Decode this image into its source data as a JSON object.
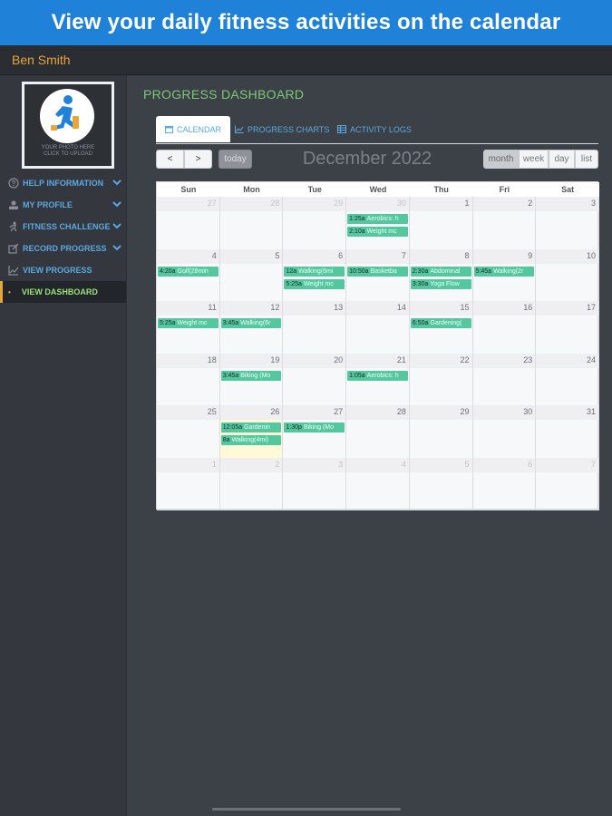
{
  "banner": {
    "title": "View your daily fitness activities on the calendar"
  },
  "user": {
    "name": "Ben Smith"
  },
  "profile": {
    "photo_caption_1": "YOUR PHOTO HERE",
    "photo_caption_2": "CLICK TO UPLOAD"
  },
  "sidebar": {
    "items": [
      {
        "label": "HELP INFORMATION",
        "icon": "question-icon"
      },
      {
        "label": "MY PROFILE",
        "icon": "profile-icon"
      },
      {
        "label": "FITNESS CHALLENGE",
        "icon": "runner-icon"
      },
      {
        "label": "RECORD PROGRESS",
        "icon": "record-icon"
      },
      {
        "label": "VIEW PROGRESS",
        "icon": "chart-icon"
      },
      {
        "label": "VIEW DASHBOARD",
        "icon": "bullet-icon"
      }
    ]
  },
  "dashboard": {
    "title": "PROGRESS DASHBOARD"
  },
  "tabs": [
    {
      "label": "CALENDAR",
      "icon": "calendar-icon"
    },
    {
      "label": "PROGRESS CHARTS",
      "icon": "line-chart-icon"
    },
    {
      "label": "ACTIVITY LOGS",
      "icon": "table-icon"
    }
  ],
  "toolbar": {
    "prev": "<",
    "next": ">",
    "today": "today",
    "month_title": "December 2022",
    "views": [
      "month",
      "week",
      "day",
      "list"
    ]
  },
  "calendar": {
    "days_of_week": [
      "Sun",
      "Mon",
      "Tue",
      "Wed",
      "Thu",
      "Fri",
      "Sat"
    ],
    "weeks": [
      [
        {
          "num": "27",
          "other": true,
          "events": []
        },
        {
          "num": "28",
          "other": true,
          "events": []
        },
        {
          "num": "29",
          "other": true,
          "events": []
        },
        {
          "num": "30",
          "other": true,
          "events": [
            {
              "time": "1:25a",
              "name": "Aerobics: h"
            },
            {
              "time": "2:10a",
              "name": "Weight mc"
            }
          ]
        },
        {
          "num": "1",
          "events": []
        },
        {
          "num": "2",
          "events": []
        },
        {
          "num": "3",
          "events": []
        }
      ],
      [
        {
          "num": "4",
          "events": [
            {
              "time": "4:20a",
              "name": "Golf(28min"
            }
          ]
        },
        {
          "num": "5",
          "events": []
        },
        {
          "num": "6",
          "events": [
            {
              "time": "12a",
              "name": "Walking(6mi"
            },
            {
              "time": "5:25a",
              "name": "Weight mc"
            }
          ]
        },
        {
          "num": "7",
          "events": [
            {
              "time": "10:50a",
              "name": "Basketba"
            }
          ]
        },
        {
          "num": "8",
          "events": [
            {
              "time": "2:30a",
              "name": "Abdominal"
            },
            {
              "time": "3:30a",
              "name": "Yoga Flow"
            }
          ]
        },
        {
          "num": "9",
          "events": [
            {
              "time": "5:45a",
              "name": "Walking(2r"
            }
          ]
        },
        {
          "num": "10",
          "events": []
        }
      ],
      [
        {
          "num": "11",
          "events": [
            {
              "time": "5:25a",
              "name": "Weight mc"
            }
          ]
        },
        {
          "num": "12",
          "events": [
            {
              "time": "3:45a",
              "name": "Walking(6r"
            }
          ]
        },
        {
          "num": "13",
          "events": []
        },
        {
          "num": "14",
          "events": []
        },
        {
          "num": "15",
          "events": [
            {
              "time": "6:50a",
              "name": "Gardening("
            }
          ]
        },
        {
          "num": "16",
          "events": []
        },
        {
          "num": "17",
          "events": []
        }
      ],
      [
        {
          "num": "18",
          "events": []
        },
        {
          "num": "19",
          "events": [
            {
              "time": "3:45a",
              "name": "Biking (Mo"
            }
          ]
        },
        {
          "num": "20",
          "events": []
        },
        {
          "num": "21",
          "events": [
            {
              "time": "1:05a",
              "name": "Aerobics: h"
            }
          ]
        },
        {
          "num": "22",
          "events": []
        },
        {
          "num": "23",
          "events": []
        },
        {
          "num": "24",
          "events": []
        }
      ],
      [
        {
          "num": "25",
          "events": []
        },
        {
          "num": "26",
          "today": true,
          "events": [
            {
              "time": "12:05a",
              "name": "Gardenin"
            },
            {
              "time": "8a",
              "name": "Walking(4mi)"
            }
          ]
        },
        {
          "num": "27",
          "events": [
            {
              "time": "1:30p",
              "name": "Biking (Mo"
            }
          ]
        },
        {
          "num": "28",
          "events": []
        },
        {
          "num": "29",
          "events": []
        },
        {
          "num": "30",
          "events": []
        },
        {
          "num": "31",
          "events": []
        }
      ],
      [
        {
          "num": "1",
          "other": true,
          "events": []
        },
        {
          "num": "2",
          "other": true,
          "events": []
        },
        {
          "num": "3",
          "other": true,
          "events": []
        },
        {
          "num": "4",
          "other": true,
          "events": []
        },
        {
          "num": "5",
          "other": true,
          "events": []
        },
        {
          "num": "6",
          "other": true,
          "events": []
        },
        {
          "num": "7",
          "other": true,
          "events": []
        }
      ]
    ]
  },
  "colors": {
    "banner": "#1f82d8",
    "event": "#55c79f",
    "accent": "#e8a53a",
    "link": "#5aa9e2",
    "active": "#9de07a"
  }
}
